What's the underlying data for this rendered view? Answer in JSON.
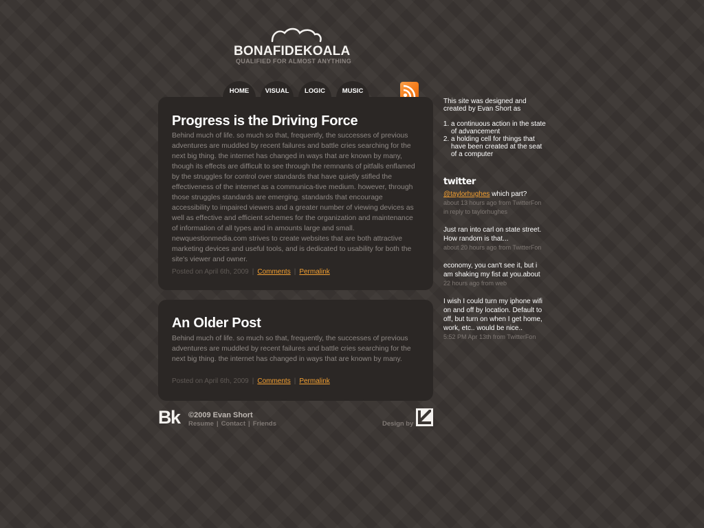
{
  "site": {
    "name": "BONAFIDEKOALA",
    "tagline": "QUALIFIED FOR ALMOST ANYTHING"
  },
  "nav": {
    "items": [
      {
        "label": "HOME"
      },
      {
        "label": "VISUAL"
      },
      {
        "label": "LOGIC"
      },
      {
        "label": "MUSIC"
      }
    ]
  },
  "rss_icon": "rss-feed-icon",
  "posts": [
    {
      "title": "Progress is the Driving Force",
      "body": "Behind much of life. so much so that, frequently, the successes of previous adventures are muddled by recent failures and battle cries searching for the next big thing. the internet has changed in ways that are known by many, though its effects are difficult to see through the remnants of pitfalls enflamed by the struggles for control over standards that have quietly stifled the effectiveness of the internet as a communica-tive medium. however, through those struggles standards are emerging. standards that encourage accessibility to impaired viewers and a greater number of viewing devices as well as effective and efficient schemes for the organization and maintenance of information of all types and in amounts large and small. newquestionmedia.com strives to create websites that are both attractive marketing devices and useful tools, and is dedicated to usability for both the site's viewer and owner.",
      "posted": "Posted on April 6th, 2009",
      "comments": "Comments",
      "permalink": "Permalink"
    },
    {
      "title": "An Older Post",
      "body": "Behind much of life. so much so that, frequently, the successes of previous adventures are muddled by recent failures and battle cries searching for the next big thing. the internet has changed in ways that are known by many.",
      "posted": "Posted on April 6th, 2009",
      "comments": "Comments",
      "permalink": "Permalink"
    }
  ],
  "sidebar": {
    "intro": "This site was designed and created by Evan Short as",
    "definitions": [
      "a continuous action in the state of advancement",
      "a holding cell for things that have been created at the seat of a computer"
    ],
    "twitter_heading": "twitter",
    "tweets": [
      {
        "mention": "@taylorhughes",
        "text": " which part?",
        "meta": "about 13 hours ago from TwitterFon in reply to taylorhughes"
      },
      {
        "mention": "",
        "text": "Just ran into carl on state street. How random is that...",
        "meta": "about 20 hours ago from TwitterFon"
      },
      {
        "mention": "",
        "text": "economy, you can't see it, but i am shaking my fist at you.about",
        "meta": "22 hours ago from web"
      },
      {
        "mention": "",
        "text": "I wish I could turn my iphone wifi on and off by location. Default to off, but turn on when I get home, work, etc.. would be nice..",
        "meta": "5:52 PM Apr 13th from TwitterFon"
      }
    ]
  },
  "footer": {
    "bk_logo": "Bk",
    "copyright": "©2009 Evan Short",
    "links": [
      "Resume",
      "Contact",
      "Friends"
    ],
    "design_by": "Design by"
  },
  "colors": {
    "background": "#3a3532",
    "panel": "#2b2725",
    "accent": "#f5a132",
    "body_text": "#8e8884",
    "rss": "#f47d1c"
  }
}
